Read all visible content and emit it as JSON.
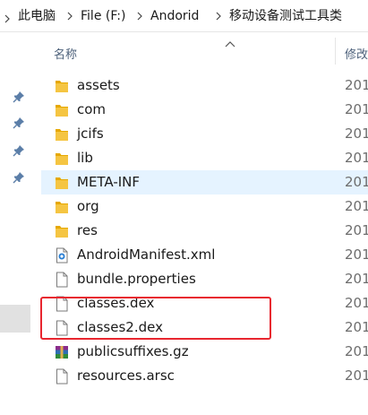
{
  "breadcrumb": {
    "items": [
      "此电脑",
      "File (F:)",
      "Andorid",
      "移动设备测试工具类"
    ]
  },
  "columns": {
    "name": "名称",
    "date": "修改"
  },
  "files": [
    {
      "name": "assets",
      "type": "folder",
      "date": "201"
    },
    {
      "name": "com",
      "type": "folder",
      "date": "201"
    },
    {
      "name": "jcifs",
      "type": "folder",
      "date": "201"
    },
    {
      "name": "lib",
      "type": "folder",
      "date": "201"
    },
    {
      "name": "META-INF",
      "type": "folder",
      "date": "201",
      "selected": true
    },
    {
      "name": "org",
      "type": "folder",
      "date": "201"
    },
    {
      "name": "res",
      "type": "folder",
      "date": "201"
    },
    {
      "name": "AndroidManifest.xml",
      "type": "xml",
      "date": "201"
    },
    {
      "name": "bundle.properties",
      "type": "file",
      "date": "201"
    },
    {
      "name": "classes.dex",
      "type": "file",
      "date": "201"
    },
    {
      "name": "classes2.dex",
      "type": "file",
      "date": "201"
    },
    {
      "name": "publicsuffixes.gz",
      "type": "archive",
      "date": "201"
    },
    {
      "name": "resources.arsc",
      "type": "file",
      "date": "201"
    }
  ],
  "icons": {
    "folder": "folder-icon",
    "xml": "xml-file-icon",
    "file": "file-icon",
    "archive": "archive-icon",
    "pin": "pin-icon"
  },
  "colors": {
    "folder": "#f5c542",
    "selection": "#e5f3ff",
    "highlight": "#e8262f",
    "header_text": "#4c607a"
  }
}
